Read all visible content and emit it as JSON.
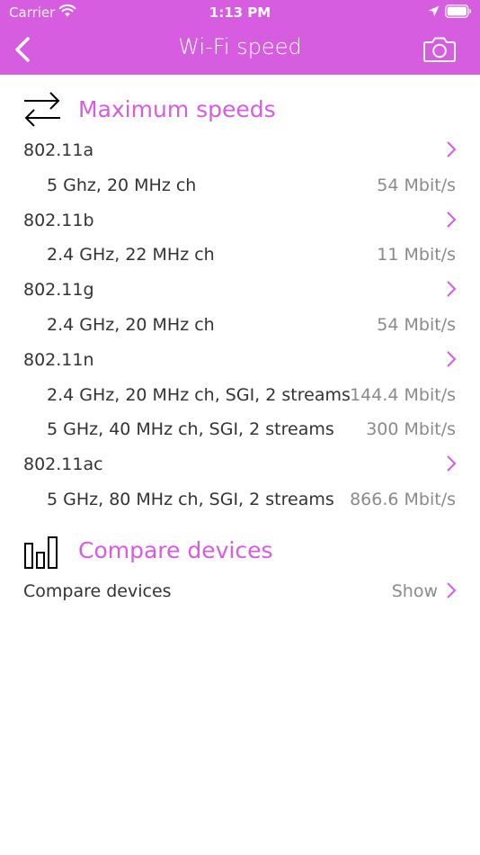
{
  "status_bar": {
    "carrier": "Carrier",
    "time": "1:13 PM"
  },
  "nav": {
    "title": "Wi-Fi speed",
    "back_icon": "chevron-left-icon",
    "camera_icon": "camera-icon"
  },
  "colors": {
    "accent": "#d65ce0",
    "text": "#333333",
    "secondary_text": "#8a8a8a"
  },
  "max_speeds": {
    "title": "Maximum speeds",
    "icon": "swap-arrows-icon",
    "standards": [
      {
        "name": "802.11a",
        "details": [
          {
            "label": "5 Ghz, 20 MHz ch",
            "speed": "54 Mbit/s"
          }
        ]
      },
      {
        "name": "802.11b",
        "details": [
          {
            "label": "2.4 GHz, 22 MHz ch",
            "speed": "11 Mbit/s"
          }
        ]
      },
      {
        "name": "802.11g",
        "details": [
          {
            "label": "2.4 GHz, 20 MHz ch",
            "speed": "54 Mbit/s"
          }
        ]
      },
      {
        "name": "802.11n",
        "details": [
          {
            "label": "2.4 GHz, 20 MHz ch, SGI, 2 streams",
            "speed": "144.4 Mbit/s"
          },
          {
            "label": "5 GHz, 40 MHz ch, SGI, 2 streams",
            "speed": "300 Mbit/s"
          }
        ]
      },
      {
        "name": "802.11ac",
        "details": [
          {
            "label": "5 GHz, 80 MHz ch, SGI, 2 streams",
            "speed": "866.6 Mbit/s"
          }
        ]
      }
    ]
  },
  "compare": {
    "title": "Compare devices",
    "icon": "bar-chart-icon",
    "row_label": "Compare devices",
    "row_value": "Show"
  }
}
